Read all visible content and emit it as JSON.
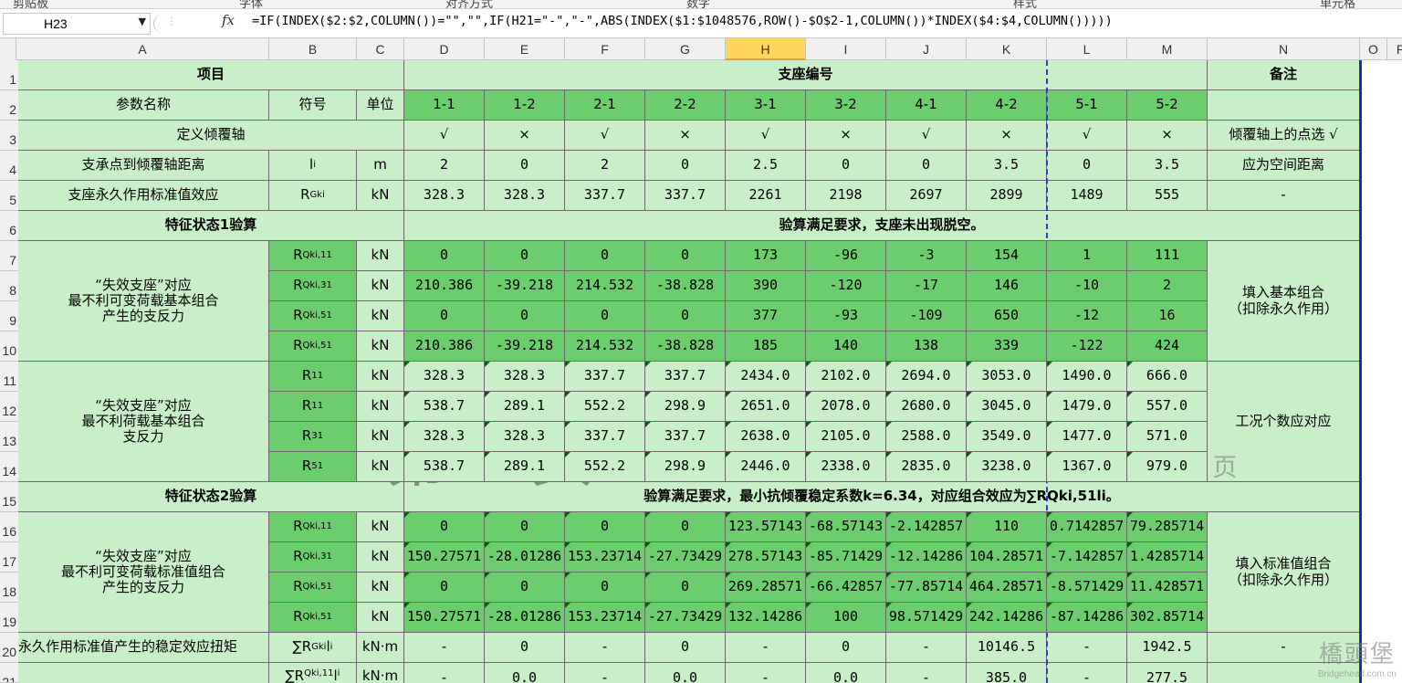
{
  "ribbon": [
    "剪贴板",
    "字体",
    "对齐方式",
    "数字",
    "样式",
    "单元格"
  ],
  "name_box": "H23",
  "formula": "=IF(INDEX($2:$2,COLUMN())=\"\",\"\",IF(H21=\"-\",\"-\",ABS(INDEX($1:$1048576,ROW()-$O$2-1,COLUMN())*INDEX($4:$4,COLUMN()))))",
  "columns": [
    "A",
    "B",
    "C",
    "D",
    "E",
    "F",
    "G",
    "H",
    "I",
    "J",
    "K",
    "L",
    "M",
    "N",
    "O",
    "P"
  ],
  "rows": [
    "1",
    "2",
    "3",
    "4",
    "5",
    "6",
    "7",
    "8",
    "9",
    "10",
    "11",
    "12",
    "13",
    "14",
    "15",
    "16",
    "17",
    "18",
    "19",
    "20",
    "21"
  ],
  "header": {
    "item": "项目",
    "support_no": "支座编号",
    "remark": "备注",
    "param_name": "参数名称",
    "symbol": "符号",
    "unit": "单位",
    "bearings": [
      "1-1",
      "1-2",
      "2-1",
      "2-2",
      "3-1",
      "3-2",
      "4-1",
      "4-2",
      "5-1",
      "5-2"
    ]
  },
  "r3": {
    "label": "定义倾覆轴",
    "values": [
      "√",
      "×",
      "√",
      "×",
      "√",
      "×",
      "√",
      "×",
      "√",
      "×"
    ],
    "remark": "倾覆轴上的点选 √"
  },
  "r4": {
    "label": "支承点到倾覆轴距离",
    "symbol": "l",
    "symbol_sub": "i",
    "unit": "m",
    "values": [
      "2",
      "0",
      "2",
      "0",
      "2.5",
      "0",
      "0",
      "3.5",
      "0",
      "3.5"
    ],
    "remark": "应为空间距离"
  },
  "r5": {
    "label": "支座永久作用标准值效应",
    "symbol": "R",
    "symbol_sub": "Gki",
    "unit": "kN",
    "values": [
      "328.3",
      "328.3",
      "337.7",
      "337.7",
      "2261",
      "2198",
      "2697",
      "2899",
      "1489",
      "555"
    ],
    "remark": "-"
  },
  "s1": {
    "label": "特征状态1验算",
    "result": "验算满足要求，支座未出现脱空。"
  },
  "g1": {
    "label_lines": [
      "“失效支座”对应",
      "最不利可变荷载基本组合",
      "产生的支反力"
    ],
    "remark_lines": [
      "填入基本组合",
      "（扣除永久作用）"
    ],
    "rows": [
      {
        "sym": "R",
        "sub": "Qki,11",
        "unit": "kN",
        "values": [
          "0",
          "0",
          "0",
          "0",
          "173",
          "-96",
          "-3",
          "154",
          "1",
          "111"
        ]
      },
      {
        "sym": "R",
        "sub": "Qki,31",
        "unit": "kN",
        "values": [
          "210.386",
          "-39.218",
          "214.532",
          "-38.828",
          "390",
          "-120",
          "-17",
          "146",
          "-10",
          "2"
        ]
      },
      {
        "sym": "R",
        "sub": "Qki,51",
        "unit": "kN",
        "values": [
          "0",
          "0",
          "0",
          "0",
          "377",
          "-93",
          "-109",
          "650",
          "-12",
          "16"
        ]
      },
      {
        "sym": "R",
        "sub": "Qki,51",
        "unit": "kN",
        "values": [
          "210.386",
          "-39.218",
          "214.532",
          "-38.828",
          "185",
          "140",
          "138",
          "339",
          "-122",
          "424"
        ]
      }
    ]
  },
  "g2": {
    "label_lines": [
      "“失效支座”对应",
      "最不利荷载基本组合",
      "支反力"
    ],
    "remark": "工况个数应对应",
    "rows": [
      {
        "sym": "R",
        "sub": "11",
        "unit": "kN",
        "values": [
          "328.3",
          "328.3",
          "337.7",
          "337.7",
          "2434.0",
          "2102.0",
          "2694.0",
          "3053.0",
          "1490.0",
          "666.0"
        ]
      },
      {
        "sym": "R",
        "sub": "11",
        "unit": "kN",
        "values": [
          "538.7",
          "289.1",
          "552.2",
          "298.9",
          "2651.0",
          "2078.0",
          "2680.0",
          "3045.0",
          "1479.0",
          "557.0"
        ]
      },
      {
        "sym": "R",
        "sub": "31",
        "unit": "kN",
        "values": [
          "328.3",
          "328.3",
          "337.7",
          "337.7",
          "2638.0",
          "2105.0",
          "2588.0",
          "3549.0",
          "1477.0",
          "571.0"
        ]
      },
      {
        "sym": "R",
        "sub": "51",
        "unit": "kN",
        "values": [
          "538.7",
          "289.1",
          "552.2",
          "298.9",
          "2446.0",
          "2338.0",
          "2835.0",
          "3238.0",
          "1367.0",
          "979.0"
        ]
      }
    ]
  },
  "s2": {
    "label": "特征状态2验算",
    "result": "验算满足要求，最小抗倾覆稳定系数k=6.34，对应组合效应为∑RQki,51li。"
  },
  "g3": {
    "label_lines": [
      "“失效支座”对应",
      "最不利可变荷载标准值组合",
      "产生的支反力"
    ],
    "remark_lines": [
      "填入标准值组合",
      "（扣除永久作用）"
    ],
    "rows": [
      {
        "sym": "R",
        "sub": "Qki,11",
        "unit": "kN",
        "values": [
          "0",
          "0",
          "0",
          "0",
          "123.57143",
          "-68.57143",
          "-2.142857",
          "110",
          "0.7142857",
          "79.285714"
        ]
      },
      {
        "sym": "R",
        "sub": "Qki,31",
        "unit": "kN",
        "values": [
          "150.27571",
          "-28.01286",
          "153.23714",
          "-27.73429",
          "278.57143",
          "-85.71429",
          "-12.14286",
          "104.28571",
          "-7.142857",
          "1.4285714"
        ]
      },
      {
        "sym": "R",
        "sub": "Qki,51",
        "unit": "kN",
        "values": [
          "0",
          "0",
          "0",
          "0",
          "269.28571",
          "-66.42857",
          "-77.85714",
          "464.28571",
          "-8.571429",
          "11.428571"
        ]
      },
      {
        "sym": "R",
        "sub": "Qki,51",
        "unit": "kN",
        "values": [
          "150.27571",
          "-28.01286",
          "153.23714",
          "-27.73429",
          "132.14286",
          "100",
          "98.571429",
          "242.14286",
          "-87.14286",
          "302.85714"
        ]
      }
    ]
  },
  "r20": {
    "label": "永久作用标准值产生的稳定效应扭矩",
    "symbol": "∑R",
    "symbol_sub": "Gki",
    "symbol_tail": "l",
    "symbol_tail_sub": "i",
    "unit": "kN·m",
    "values": [
      "-",
      "0",
      "-",
      "0",
      "-",
      "0",
      "-",
      "10146.5",
      "-",
      "1942.5"
    ],
    "remark": "-"
  },
  "r21": {
    "symbol": "∑R",
    "symbol_sub": "Qki,11",
    "symbol_tail": "l",
    "symbol_tail_sub": "i",
    "unit": "kN·m",
    "values": [
      "-",
      "0.0",
      "-",
      "0.0",
      "-",
      "0.0",
      "-",
      "385.0",
      "-",
      "277.5"
    ]
  },
  "watermark_page1": "第 1 页",
  "watermark_page2": "第 2 页",
  "logo_main": "橋頭堡",
  "logo_sub": "Bridgehead.com.cn"
}
